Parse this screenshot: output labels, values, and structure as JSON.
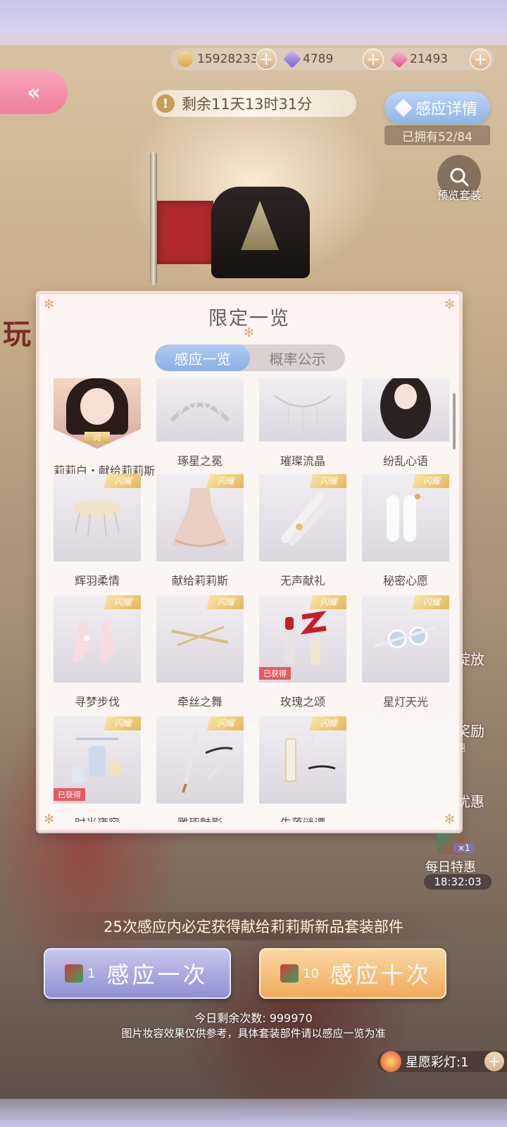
{
  "currency": [
    {
      "name": "gold",
      "icon": "cat-coin-icon",
      "value": "15928233"
    },
    {
      "name": "crystal",
      "icon": "purple-diamond-icon",
      "value": "4789"
    },
    {
      "name": "gem",
      "icon": "pink-diamond-icon",
      "value": "21493"
    }
  ],
  "header": {
    "countdown": "剩余11天13时31分",
    "detail_label": "感应详情",
    "owned": "已拥有52/84",
    "preview_label": "预览套装"
  },
  "background_text": {
    "play": "玩",
    "side": [
      "绽放",
      "奖励",
      "惠",
      "优惠"
    ]
  },
  "modal": {
    "title": "限定一览",
    "tabs": [
      {
        "label": "感应一览",
        "active": true
      },
      {
        "label": "概率公示",
        "active": false
      }
    ],
    "badges": {
      "glint": "闪耀",
      "obtained": "已获得",
      "portrait": "闪"
    },
    "items": [
      {
        "name": "莉莉白・献给莉莉斯",
        "glint": false,
        "obtained": false,
        "kind": "portrait"
      },
      {
        "name": "琢星之冕",
        "glint": false,
        "obtained": false,
        "kind": "crown"
      },
      {
        "name": "璀璨流晶",
        "glint": false,
        "obtained": false,
        "kind": "chain"
      },
      {
        "name": "纷乱心语",
        "glint": false,
        "obtained": false,
        "kind": "hair"
      },
      {
        "name": "辉羽柔情",
        "glint": true,
        "obtained": false,
        "kind": "feather"
      },
      {
        "name": "献给莉莉斯",
        "glint": true,
        "obtained": false,
        "kind": "dress"
      },
      {
        "name": "无声献礼",
        "glint": true,
        "obtained": false,
        "kind": "gloves"
      },
      {
        "name": "秘密心愿",
        "glint": true,
        "obtained": false,
        "kind": "stockings"
      },
      {
        "name": "寻梦步伐",
        "glint": true,
        "obtained": false,
        "kind": "shoes"
      },
      {
        "name": "牵丝之舞",
        "glint": true,
        "obtained": false,
        "kind": "hairpin"
      },
      {
        "name": "玫瑰之颂",
        "glint": true,
        "obtained": true,
        "kind": "lipstick"
      },
      {
        "name": "星灯天光",
        "glint": true,
        "obtained": false,
        "kind": "brooch"
      },
      {
        "name": "时光雍容",
        "glint": true,
        "obtained": true,
        "kind": "vanity"
      },
      {
        "name": "雕琢魅影",
        "glint": true,
        "obtained": false,
        "kind": "brush"
      },
      {
        "name": "失落谜谭",
        "glint": true,
        "obtained": false,
        "kind": "lashes"
      }
    ]
  },
  "bottom": {
    "guarantee": "25次感应内必定获得献给莉莉斯新品套装部件",
    "pull_one": {
      "count": "1",
      "label": "感应一次"
    },
    "pull_ten": {
      "count": "10",
      "label": "感应十次"
    },
    "remaining": "今日剩余次数: 999970",
    "disclaimer": "图片妆容效果仅供参考，具体套装部件请以感应一览为准",
    "lantern": "星愿彩灯:1"
  },
  "daily_deal": {
    "label": "每日特惠",
    "timer": "18:32:03",
    "multiplier": "×1"
  }
}
